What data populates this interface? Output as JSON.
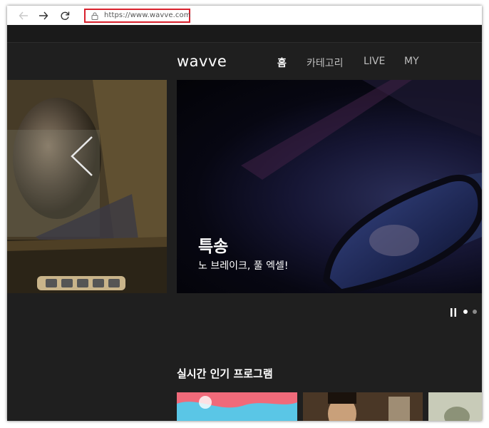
{
  "browser": {
    "url": "https://www.wavve.com",
    "back_icon": "arrow-left-icon",
    "forward_icon": "arrow-right-icon",
    "reload_icon": "reload-icon",
    "lock_icon": "lock-icon"
  },
  "site": {
    "logo": "wavve",
    "nav": [
      {
        "label": "홈",
        "active": true
      },
      {
        "label": "카테고리",
        "active": false
      },
      {
        "label": "LIVE",
        "active": false
      },
      {
        "label": "MY",
        "active": false
      }
    ]
  },
  "hero": {
    "title": "특송",
    "subtitle": "노 브레이크, 풀 엑셀!",
    "prev_icon": "chevron-left-icon",
    "pause_icon": "pause-icon",
    "slide_index": 1,
    "slide_count": 2
  },
  "section": {
    "title": "실시간 인기 프로그램"
  },
  "colors": {
    "background": "#1f1f1f",
    "highlight_box": "#d8212d",
    "active_nav": "#ffffff",
    "inactive_nav": "#bdbdbd"
  }
}
